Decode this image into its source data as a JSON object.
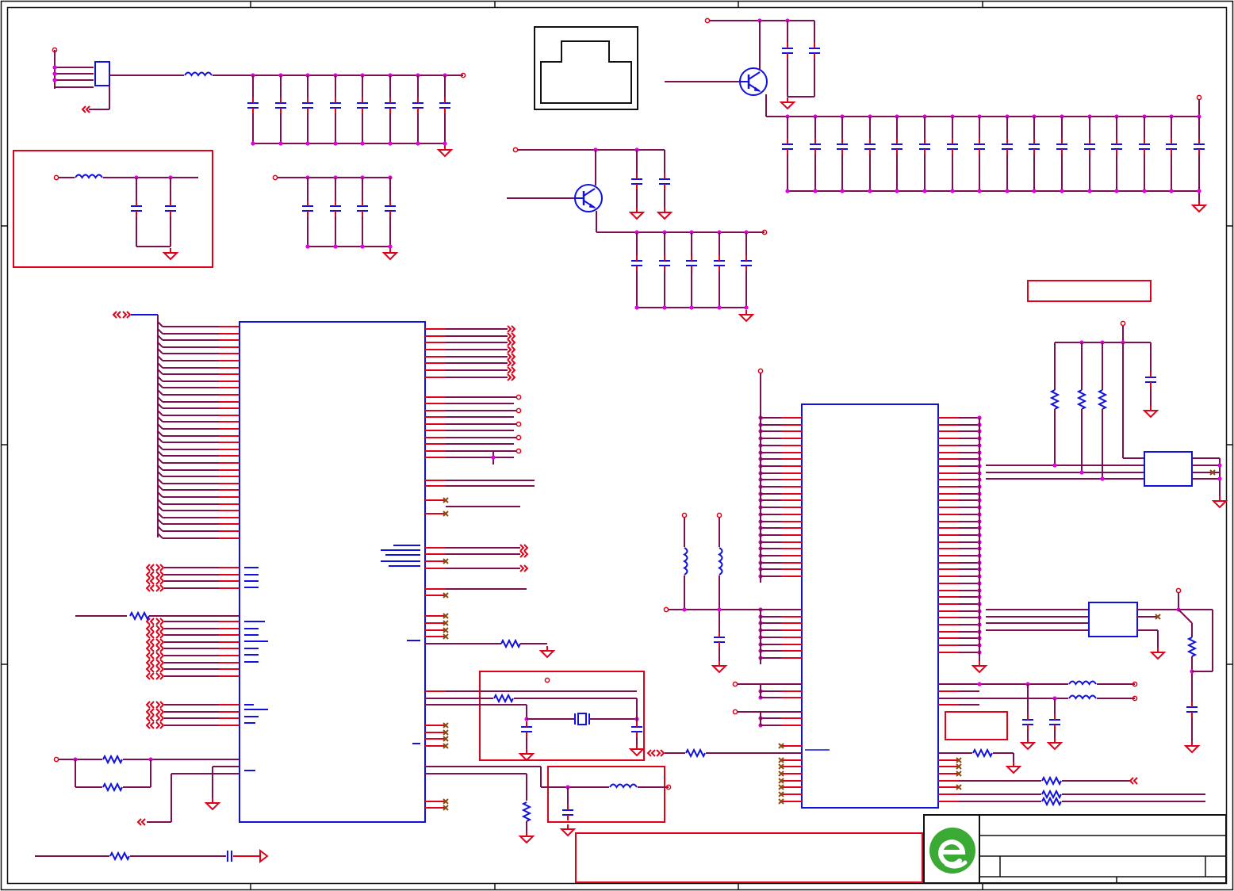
{
  "sheet": {
    "title_block_text": "",
    "notes_text": ""
  },
  "colors": {
    "wire": "#7a1050",
    "pin": "#e0001a",
    "component": "#1010e0",
    "junction": "#e000e0",
    "no_connect": "#8b4a10",
    "logo_green": "#3aaa35"
  },
  "symbols": [
    "inductor",
    "capacitor",
    "resistor",
    "ground",
    "pnp-transistor",
    "crystal",
    "mosfet",
    "off-page-connector",
    "no-connect-marker"
  ]
}
